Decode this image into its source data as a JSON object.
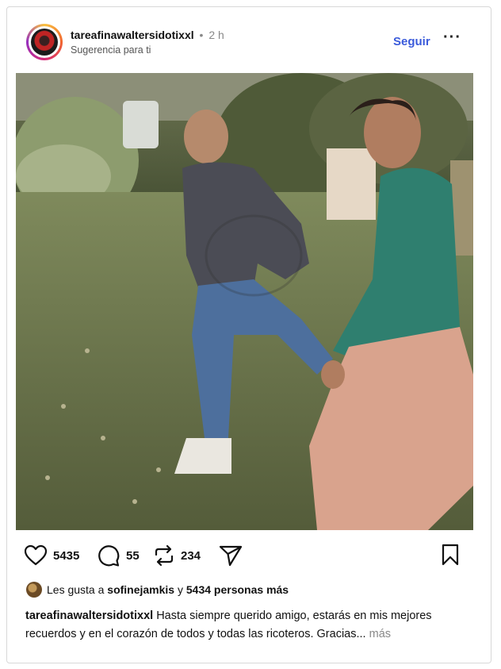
{
  "header": {
    "username": "tareafinawaltersidotixxl",
    "separator": "•",
    "time": "2 h",
    "subtitle": "Sugerencia para ti",
    "follow_label": "Seguir",
    "more_label": "···"
  },
  "post": {
    "image_alt": "Dos hombres jugando en un jardín"
  },
  "actions": {
    "like_count": "5435",
    "comment_count": "55",
    "repost_count": "234"
  },
  "likes": {
    "prefix": "Les gusta a",
    "user": "sofinejamkis",
    "connector": "y",
    "others": "5434 personas más"
  },
  "caption": {
    "username": "tareafinawaltersidotixxl",
    "text": "Hasta siempre querido amigo, estarás en mis mejores recuerdos y en el corazón de todos y todas las ricoteros. Gracias...",
    "more_label": "más"
  }
}
